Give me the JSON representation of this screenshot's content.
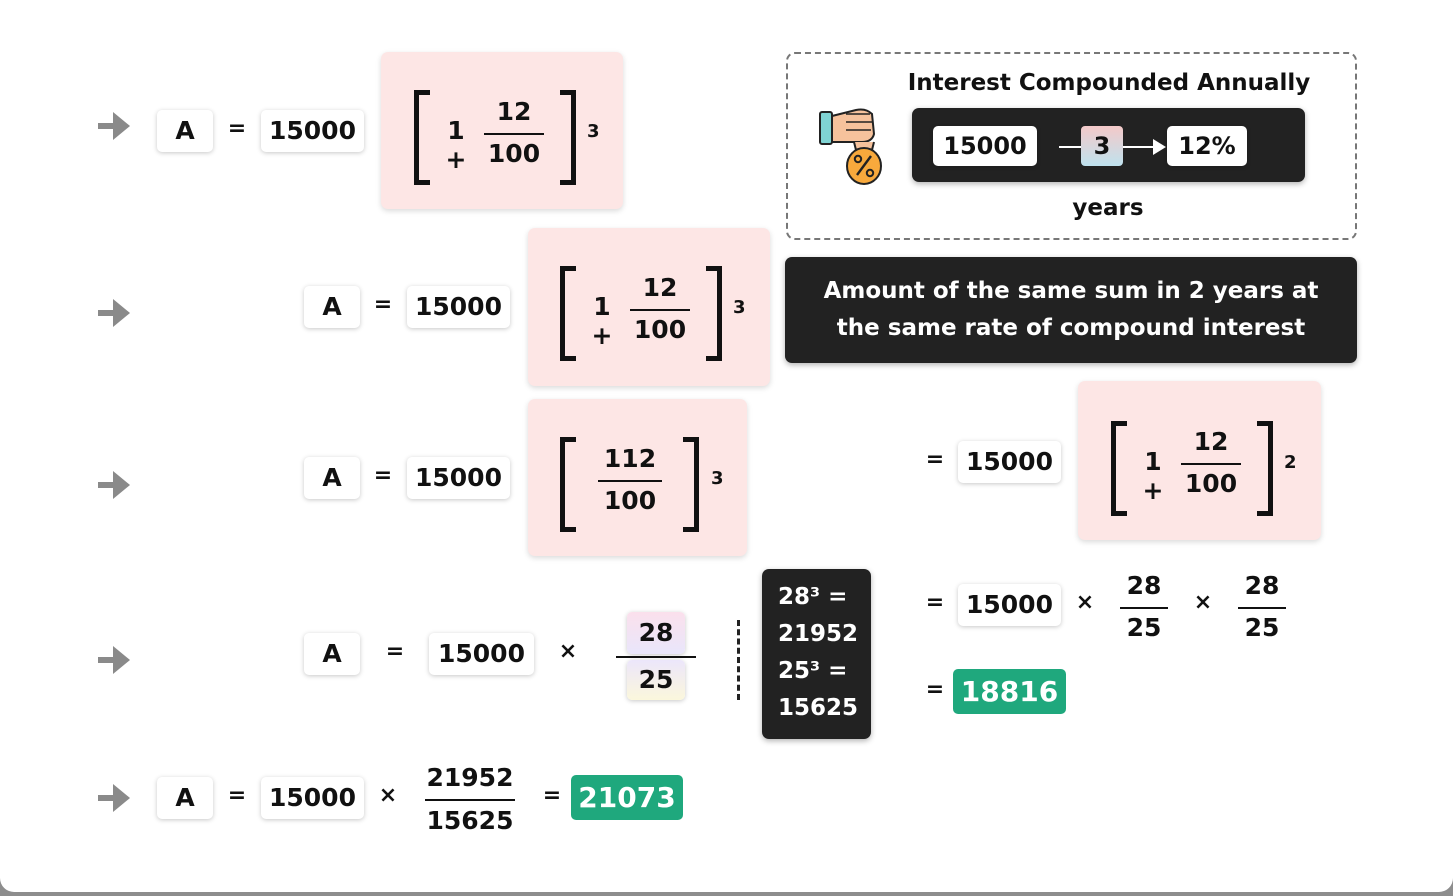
{
  "colors": {
    "pink_highlight": "#fde6e5",
    "green_result": "#1fa87d",
    "dark_panel": "#222222",
    "arrow_gray": "#8a8a8a"
  },
  "icons": [
    "arrow-right-icon",
    "hand-money-bag-percent-icon"
  ],
  "info_box": {
    "title": "Interest Compounded Annually",
    "principal": "15000",
    "years": "3",
    "rate": "12%",
    "years_label": "years"
  },
  "row1": {
    "lhs": "A",
    "eq": "=",
    "principal": "15000",
    "one_plus": "1 +",
    "num": "12",
    "den": "100",
    "exp": "3"
  },
  "row2": {
    "lhs": "A",
    "eq": "=",
    "principal": "15000",
    "one_plus": "1 +",
    "num": "12",
    "den": "100",
    "exp": "3"
  },
  "row3": {
    "lhs": "A",
    "eq": "=",
    "principal": "15000",
    "num": "112",
    "den": "100",
    "exp": "3"
  },
  "row4": {
    "lhs": "A",
    "eq": "=",
    "principal": "15000",
    "times": "×",
    "num": "28",
    "den": "25"
  },
  "row5": {
    "lhs": "A",
    "eq": "=",
    "principal": "15000",
    "times": "×",
    "num": "21952",
    "den": "15625",
    "eq2": "=",
    "result": "21073"
  },
  "cube_note": {
    "line1": "28³ =",
    "line2": "21952",
    "line3": "25³ =",
    "line4": "15625"
  },
  "right_panel": {
    "heading_line1": "Amount of the same sum in 2 years at",
    "heading_line2": "the same rate of compound interest",
    "step1": {
      "eq": "=",
      "principal": "15000",
      "one_plus": "1 +",
      "num": "12",
      "den": "100",
      "exp": "2"
    },
    "step2": {
      "eq": "=",
      "principal": "15000",
      "times1": "×",
      "num1": "28",
      "den1": "25",
      "times2": "×",
      "num2": "28",
      "den2": "25"
    },
    "step3": {
      "eq": "=",
      "result": "18816"
    }
  }
}
